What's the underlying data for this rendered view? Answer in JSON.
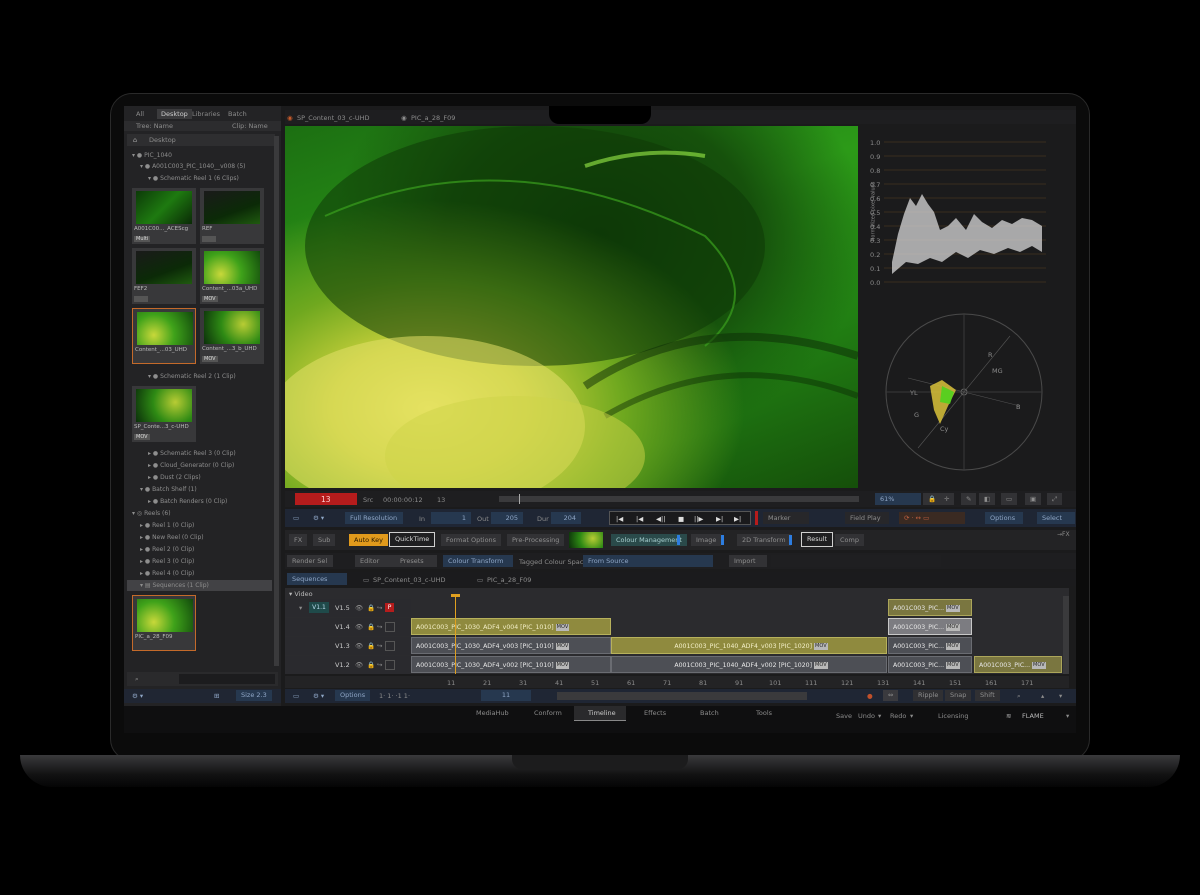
{
  "browser": {
    "tabs": [
      "All",
      "Desktop",
      "Libraries",
      "Batch"
    ],
    "header_left": "Tree: Name",
    "header_right": "Clip: Name",
    "tree_root": "Desktop",
    "tree": [
      {
        "label": "PIC_1040"
      },
      {
        "label": "A001C003_PIC_1040__v008 (5)"
      },
      {
        "label": "Schematic Reel 1 (6 Clips)"
      },
      {
        "label": "Schematic Reel 2 (1 Clip)"
      },
      {
        "label": "Schematic Reel 3 (0 Clip)"
      },
      {
        "label": "Cloud_Generator (0 Clip)"
      },
      {
        "label": "Dust (2 Clips)"
      },
      {
        "label": "Batch Shelf (1)"
      },
      {
        "label": "Batch Renders (0 Clip)"
      },
      {
        "label": "Reels (6)"
      },
      {
        "label": "Reel 1 (0 Clip)"
      },
      {
        "label": "New Reel (0 Clip)"
      },
      {
        "label": "Reel 2 (0 Clip)"
      },
      {
        "label": "Reel 3 (0 Clip)"
      },
      {
        "label": "Reel 4 (0 Clip)"
      },
      {
        "label": "Sequences (1 Clip)"
      }
    ],
    "thumbs": [
      {
        "label": "A001C00..._ACEScg",
        "badge": "Multi"
      },
      {
        "label": "REF",
        "badge": ""
      },
      {
        "label": "FEF2",
        "badge": ""
      },
      {
        "label": "Content_...03a_UHD",
        "badge": "MOV"
      },
      {
        "label": "Content_...03_UHD",
        "badge": ""
      },
      {
        "label": "Content_...3_b_UHD",
        "badge": "MOV"
      },
      {
        "label": "SP_Conte...3_c-UHD",
        "badge": "MOV"
      },
      {
        "label": "PIC_a_28_F09",
        "badge": ""
      }
    ],
    "footer_size": "Size 2.3"
  },
  "viewer_tabs": [
    "SP_Content_03_c-UHD",
    "PIC_a_28_F09"
  ],
  "scopes": {
    "waveform_ticks": [
      "1.0",
      "0.9",
      "0.8",
      "0.7",
      "0.6",
      "0.5",
      "0.4",
      "0.3",
      "0.2",
      "0.1",
      "0.0"
    ],
    "waveform_axis_label": "Normalized pixel values",
    "vectorscope_labels": [
      "R",
      "MG",
      "B",
      "Cy",
      "G",
      "YL"
    ]
  },
  "transport": {
    "frame": "13",
    "src_label": "Src",
    "src_tc": "00:00:00:12",
    "src_frame": "13",
    "zoom": "61%",
    "resolution": "Full Resolution",
    "in_label": "In",
    "in_val": "1",
    "out_label": "Out",
    "out_val": "205",
    "dur_label": "Dur",
    "dur_val": "204",
    "marker": "Marker",
    "play_mode": "Field Play",
    "options": "Options",
    "select": "Select"
  },
  "pipeline": {
    "fx": "FX",
    "sub": "Sub",
    "auto_key": "Auto Key",
    "quicktime": "QuickTime",
    "format_options": "Format Options",
    "pre_processing": "Pre-Processing",
    "colour_management": "Colour Management",
    "image": "Image",
    "transform": "2D Transform",
    "result": "Result",
    "comp": "Comp",
    "fx_right": "→FX",
    "render_sel": "Render Sel",
    "editor": "Editor",
    "presets": "Presets",
    "colour_transform": "Colour Transform",
    "tagged_colour_space": "Tagged Colour Space",
    "from_source": "From Source",
    "import": "Import"
  },
  "timeline": {
    "tabs": [
      "Sequences",
      "SP_Content_03_c-UHD",
      "PIC_a_28_F09"
    ],
    "video_label": "Video",
    "tracks": [
      "V1.5",
      "V1.4",
      "V1.3",
      "V1.2"
    ],
    "v1_label": "V1.1",
    "clips": {
      "v15_right": "A001C003_PIC...",
      "v14_left": "A001C003_PIC_1030_ADF4_v004 [PIC_1010]",
      "v14_right": "A001C003_PIC...",
      "v13_left": "A001C003_PIC_1030_ADF4_v003 [PIC_1010]",
      "v13_mid": "A001C003_PIC_1040_ADF4_v003 [PIC_1020]",
      "v13_right": "A001C003_PIC...",
      "v12_left": "A001C003_PIC_1030_ADF4_v002 [PIC_1010]",
      "v12_mid": "A001C003_PIC_1040_ADF4_v002 [PIC_1020]",
      "v12_right": "A001C003_PIC...",
      "v12_far": "A001C003_PIC..."
    },
    "mov": "MOV",
    "ruler": [
      "11",
      "21",
      "31",
      "41",
      "51",
      "61",
      "71",
      "81",
      "91",
      "101",
      "111",
      "121",
      "131",
      "141",
      "151",
      "161",
      "171"
    ],
    "bottom_options": "Options",
    "bottom_frame": "11",
    "bottom_right": [
      "Ripple",
      "Snap",
      "Shift"
    ]
  },
  "workspace_tabs": [
    "MediaHub",
    "Conform",
    "Timeline",
    "Effects",
    "Batch",
    "Tools"
  ],
  "statusbar": {
    "save": "Save",
    "undo": "Undo",
    "redo": "Redo",
    "licensing": "Licensing",
    "product": "FLAME"
  },
  "colors": {
    "accent_orange": "#e19a1c",
    "timeline_gold": "#8f8a3e",
    "record_red": "#b51c1c",
    "blue_button": "#26384f"
  }
}
